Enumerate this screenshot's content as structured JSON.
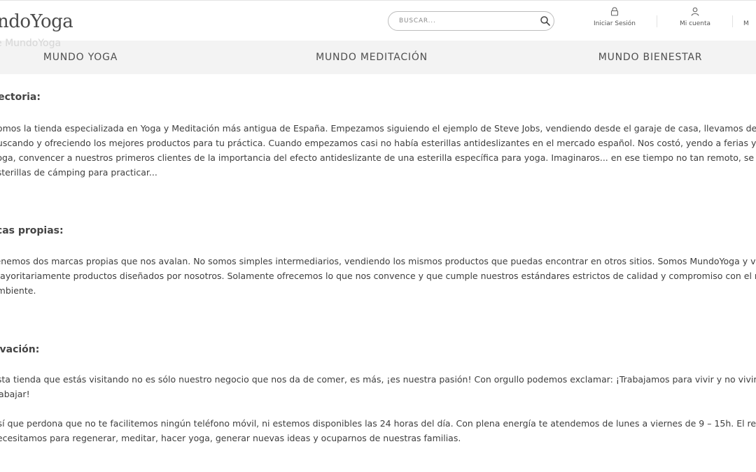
{
  "header": {
    "logo_text": "ndoYoga",
    "search": {
      "placeholder": "BUSCAR..."
    },
    "account_links": [
      {
        "label": "Iniciar Sesión",
        "icon": "lock-icon"
      },
      {
        "label": "Mi cuenta",
        "icon": "user-icon"
      },
      {
        "label": "M"
      }
    ]
  },
  "ghost_heading": "e MundoYoga",
  "nav": {
    "items": [
      {
        "label": "MUNDO YOGA"
      },
      {
        "label": "MUNDO MEDITACIÓN"
      },
      {
        "label": "MUNDO BIENESTAR"
      }
    ]
  },
  "sections": [
    {
      "heading": "yectoria:",
      "paragraphs": [
        [
          "Somos la tienda especializada en Yoga y Meditación más antigua de España. Empezamos siguiendo el ejemplo de Steve Jobs, vendiendo desde el garaje de casa, llevamos desde",
          "buscando y ofreciendo los mejores productos para tu práctica. Cuando empezamos casi no había esterillas antideslizantes en el mercado español. Nos costó, yendo a ferias y event",
          "yoga, convencer a nuestros primeros clientes de la importancia del efecto antideslizante de una esterilla específica para yoga. Imaginaros... en ese tiempo no tan remoto, se utiliz",
          "esterillas de cámping para practicar..."
        ]
      ]
    },
    {
      "heading": "rcas propias:",
      "paragraphs": [
        [
          "Tenemos dos marcas propias que nos avalan. No somos simples intermediarios, vendiendo los mismos productos que puedas encontrar en otros sitios. Somos MundoYoga y vend",
          "mayoritariamente productos diseñados por nosotros. Solamente ofrecemos lo que nos convence y que cumple nuestros estándares estrictos de calidad y compromiso con el n",
          "ambiente."
        ]
      ]
    },
    {
      "heading": "tivación:",
      "paragraphs": [
        [
          "Esta tienda que estás visitando no es sólo nuestro negocio que nos da de comer, es más, ¡es nuestra pasión! Con orgullo podemos exclamar: ¡Trabajamos para vivir y no vivimos",
          "trabajar!"
        ],
        [
          "Así que perdona que no te facilitemos ningún teléfono móvil, ni estemos disponibles las 24 horas del día. Con plena energía te atendemos de lunes a viernes de 9 – 15h. El resto del",
          "necesitamos para regenerar, meditar, hacer yoga, generar nuevas ideas y ocuparnos de nuestras familias."
        ]
      ]
    }
  ]
}
